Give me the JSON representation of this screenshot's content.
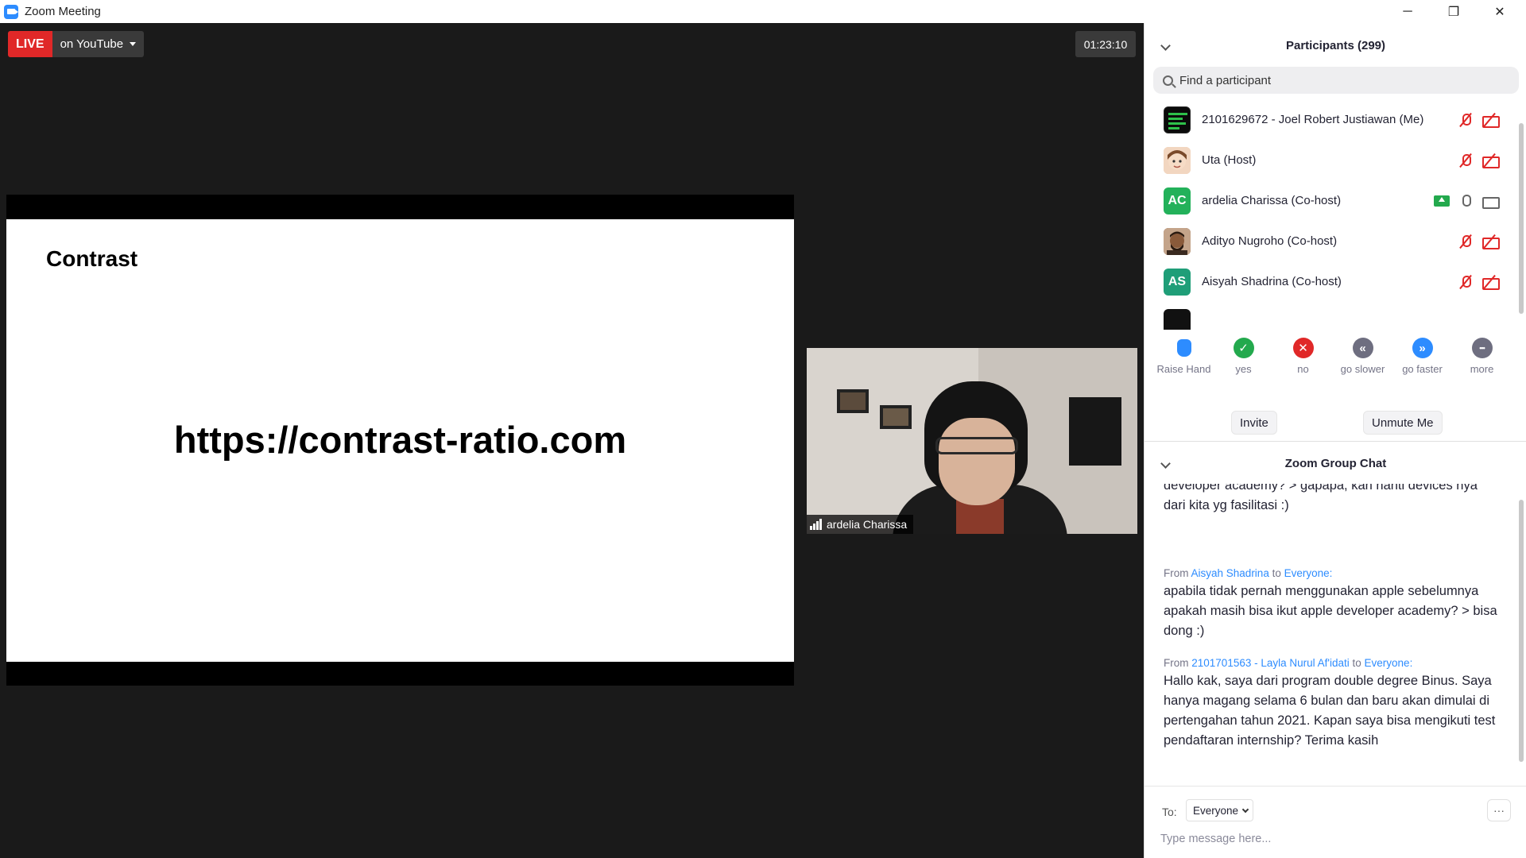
{
  "window": {
    "title": "Zoom Meeting",
    "minimize": "─",
    "maximize": "❐",
    "close": "✕"
  },
  "live": {
    "badge": "LIVE",
    "platform": "on YouTube"
  },
  "timer": "01:23:10",
  "slide": {
    "title": "Contrast",
    "url": "https://contrast-ratio.com"
  },
  "video": {
    "name": "ardelia Charissa"
  },
  "participants": {
    "header": "Participants (299)",
    "search_placeholder": "Find a participant",
    "items": [
      {
        "name": "2101629672 - Joel Robert Justiawan (Me)",
        "initials": "",
        "color": "#111111",
        "muted": true,
        "video_off": true
      },
      {
        "name": "Uta (Host)",
        "initials": "",
        "color": "#c98a5e",
        "muted": true,
        "video_off": true
      },
      {
        "name": "ardelia Charissa (Co-host)",
        "initials": "AC",
        "color": "#23b15a",
        "muted": false,
        "video_off": false,
        "sharing": true
      },
      {
        "name": "Adityo Nugroho (Co-host)",
        "initials": "",
        "color": "#7a4a2e",
        "muted": true,
        "video_off": true
      },
      {
        "name": "Aisyah Shadrina (Co-host)",
        "initials": "AS",
        "color": "#1f9e78",
        "muted": true,
        "video_off": true
      }
    ]
  },
  "reactions": [
    {
      "label": "Raise Hand",
      "icon": "hand-icon",
      "color": "#2d8cff"
    },
    {
      "label": "yes",
      "icon": "check-icon",
      "color": "#23a94d",
      "glyph": "✓"
    },
    {
      "label": "no",
      "icon": "x-icon",
      "color": "#e02828",
      "glyph": "✕"
    },
    {
      "label": "go slower",
      "icon": "rewind-icon",
      "color": "#6e6e80",
      "glyph": "«"
    },
    {
      "label": "go faster",
      "icon": "forward-icon",
      "color": "#2d8cff",
      "glyph": "»"
    },
    {
      "label": "more",
      "icon": "more-icon",
      "color": "#6e6e80",
      "glyph": "•••"
    }
  ],
  "buttons": {
    "invite": "Invite",
    "unmute": "Unmute Me"
  },
  "chat": {
    "header": "Zoom Group Chat",
    "messages": [
      {
        "from": "",
        "to": "",
        "text": "developer academy? > gapapa, kan nanti devices nya dari kita yg fasilitasi :)"
      },
      {
        "from": "Aisyah Shadrina",
        "to": "Everyone:",
        "text": "apabila tidak pernah menggunakan apple sebelumnya apakah masih bisa ikut apple developer academy? > bisa dong :)"
      },
      {
        "from": "2101701563 - Layla Nurul Af'idati",
        "to": "Everyone:",
        "text": "Hallo kak, saya dari program double degree Binus. Saya hanya magang selama 6 bulan dan baru akan dimulai di pertengahan tahun 2021. Kapan saya bisa mengikuti test pendaftaran internship? Terima kasih"
      }
    ],
    "meta_from": "From",
    "meta_to": "to",
    "to_label": "To:",
    "to_value": "Everyone",
    "input_placeholder": "Type message here...",
    "more": "···"
  }
}
